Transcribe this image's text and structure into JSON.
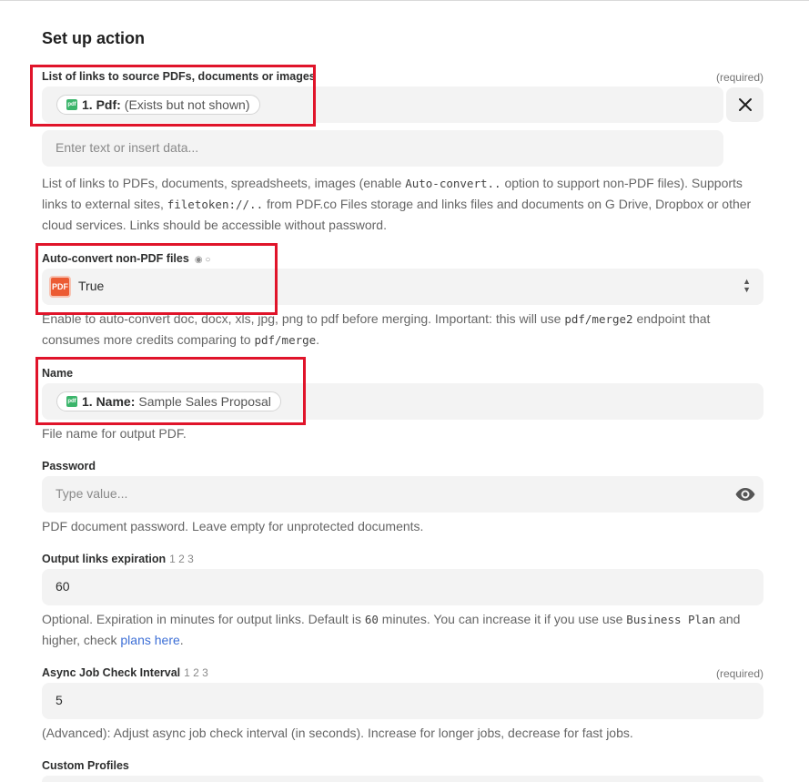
{
  "header": {
    "title": "Set up action"
  },
  "fields": {
    "source_links": {
      "label": "List of links to source PDFs, documents or images",
      "required": "(required)",
      "pill_key": "1. Pdf:",
      "pill_value": "(Exists but not shown)",
      "placeholder": "Enter text or insert data...",
      "help_1": "List of links to PDFs, documents, spreadsheets, images (enable ",
      "help_code_1": "Auto-convert..",
      "help_2": " option to support non-PDF files). Supports links to external sites, ",
      "help_code_2": "filetoken://..",
      "help_3": " from PDF.co Files storage and links files and documents on G Drive, Dropbox or other cloud services. Links should be accessible without password."
    },
    "auto_convert": {
      "label": "Auto-convert non-PDF files",
      "radios": "◉ ○",
      "icon_text": "PDF",
      "value": "True",
      "help_1": "Enable to auto-convert doc, docx, xls, jpg, png to pdf before merging. Important: this will use ",
      "help_code_1": "pdf/merge2",
      "help_2": " endpoint that consumes more credits comparing to ",
      "help_code_2": "pdf/merge",
      "help_3": "."
    },
    "name": {
      "label": "Name",
      "pill_key": "1. Name:",
      "pill_value": "Sample Sales Proposal",
      "help": "File name for output PDF."
    },
    "password": {
      "label": "Password",
      "placeholder": "Type value...",
      "help": "PDF document password. Leave empty for unprotected documents."
    },
    "expiration": {
      "label": "Output links expiration",
      "nums": "1 2 3",
      "value": "60",
      "help_1": "Optional. Expiration in minutes for output links. Default is ",
      "help_code_1": "60",
      "help_2": " minutes. You can increase it if you use use ",
      "help_code_2": "Business Plan",
      "help_3": " and higher, check ",
      "help_link": "plans here",
      "help_4": "."
    },
    "async_interval": {
      "label": "Async Job Check Interval",
      "nums": "1 2 3",
      "required": "(required)",
      "value": "5",
      "help": "(Advanced): Adjust async job check interval (in seconds). Increase for longer jobs, decrease for fast jobs."
    },
    "custom_profiles": {
      "label": "Custom Profiles"
    }
  },
  "icons": {
    "close": "close-icon",
    "eye": "eye-icon",
    "pdf_tag": "pdf-tag-icon"
  },
  "colors": {
    "highlight": "#e0142a",
    "field_bg": "#f3f3f3",
    "link": "#3d6fd6"
  }
}
